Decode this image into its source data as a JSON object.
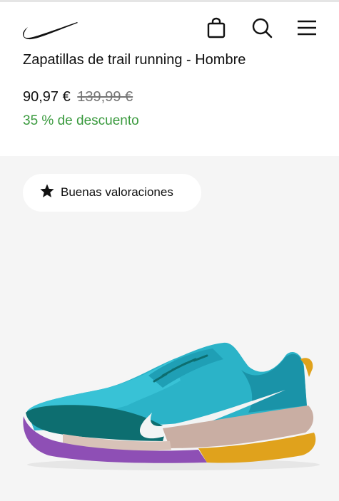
{
  "colors": {
    "accent_discount": "#3a9a3e",
    "text": "#111111",
    "muted": "#757575",
    "gallery_bg": "#f5f5f5",
    "shoe_teal": "#2bb3c8",
    "shoe_dark_teal": "#0d6e70",
    "sole_purple": "#8e4fb5",
    "sole_yellow": "#e0a21c",
    "sole_taupe": "#c9aea3"
  },
  "header": {
    "logo_icon": "nike-swoosh-icon",
    "icons": [
      "bag-icon",
      "search-icon",
      "menu-icon"
    ]
  },
  "product": {
    "title": "Zapatillas de trail running - Hombre",
    "price_current": "90,97 €",
    "price_original": "139,99 €",
    "discount": "35 % de descuento"
  },
  "gallery": {
    "badge_icon": "star-icon",
    "badge_label": "Buenas valoraciones"
  }
}
